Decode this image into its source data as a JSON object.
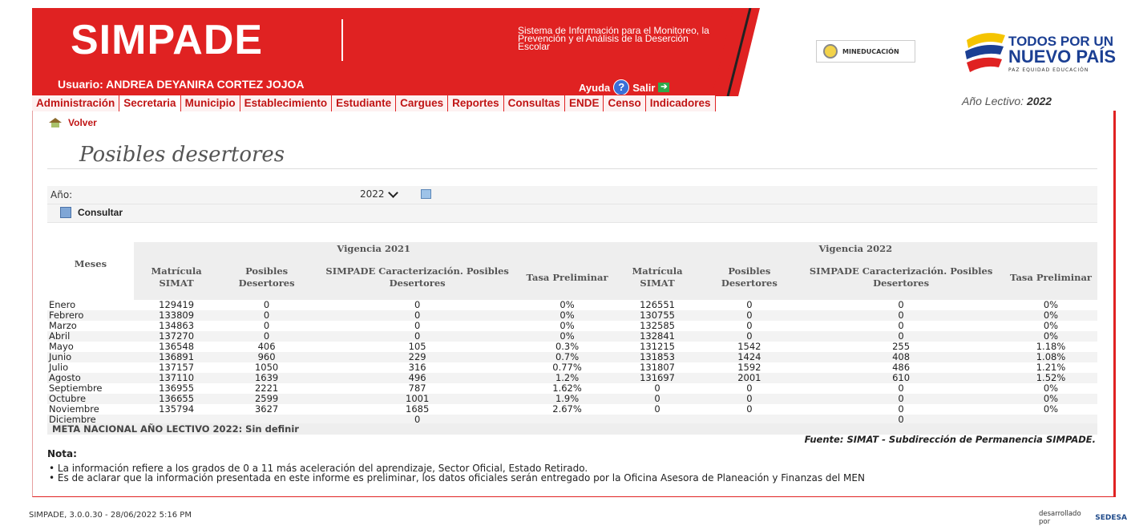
{
  "header": {
    "logo": "SIMPADE",
    "system_description": "Sistema de Información para el Monitoreo, la Prevención y el Análisis de la Deserción Escolar",
    "user": "Usuario: ANDREA DEYANIRA CORTEZ JOJOA",
    "help_label": "Ayuda",
    "exit_label": "Salir",
    "mineducacion": "MINEDUCACIÓN",
    "todos_line1": "TODOS POR UN",
    "todos_line2": "NUEVO PAÍS",
    "todos_tagline": "PAZ   EQUIDAD   EDUCACIÓN",
    "anio_lectivo_label": "Año Lectivo:",
    "anio_lectivo_value": "2022"
  },
  "nav": [
    "Administración",
    "Secretaria",
    "Municipio",
    "Establecimiento",
    "Estudiante",
    "Cargues",
    "Reportes",
    "Consultas",
    "ENDE",
    "Censo",
    "Indicadores"
  ],
  "volver_label": "Volver",
  "page_title": "Posibles desertores",
  "form": {
    "year_label": "Año:",
    "year_value": "2022",
    "consultar_label": "Consultar"
  },
  "table": {
    "meses_header": "Meses",
    "vigencia_2021": "Vigencia 2021",
    "vigencia_2022": "Vigencia 2022",
    "col_matricula": "Matrícula SIMAT",
    "col_posibles": "Posibles Desertores",
    "col_simpade": "SIMPADE Caracterización. Posibles Desertores",
    "col_tasa": "Tasa Preliminar",
    "rows": [
      [
        "Enero",
        "129419",
        "0",
        "0",
        "0%",
        "126551",
        "0",
        "0",
        "0%"
      ],
      [
        "Febrero",
        "133809",
        "0",
        "0",
        "0%",
        "130755",
        "0",
        "0",
        "0%"
      ],
      [
        "Marzo",
        "134863",
        "0",
        "0",
        "0%",
        "132585",
        "0",
        "0",
        "0%"
      ],
      [
        "Abril",
        "137270",
        "0",
        "0",
        "0%",
        "132841",
        "0",
        "0",
        "0%"
      ],
      [
        "Mayo",
        "136548",
        "406",
        "105",
        "0.3%",
        "131215",
        "1542",
        "255",
        "1.18%"
      ],
      [
        "Junio",
        "136891",
        "960",
        "229",
        "0.7%",
        "131853",
        "1424",
        "408",
        "1.08%"
      ],
      [
        "Julio",
        "137157",
        "1050",
        "316",
        "0.77%",
        "131807",
        "1592",
        "486",
        "1.21%"
      ],
      [
        "Agosto",
        "137110",
        "1639",
        "496",
        "1.2%",
        "131697",
        "2001",
        "610",
        "1.52%"
      ],
      [
        "Septiembre",
        "136955",
        "2221",
        "787",
        "1.62%",
        "0",
        "0",
        "0",
        "0%"
      ],
      [
        "Octubre",
        "136655",
        "2599",
        "1001",
        "1.9%",
        "0",
        "0",
        "0",
        "0%"
      ],
      [
        "Noviembre",
        "135794",
        "3627",
        "1685",
        "2.67%",
        "0",
        "0",
        "0",
        "0%"
      ],
      [
        "Diciembre",
        "",
        "",
        "0",
        "",
        "",
        "",
        "0",
        ""
      ]
    ]
  },
  "meta": "META NACIONAL AÑO LECTIVO 2022: Sin definir",
  "fuente": "Fuente: SIMAT - Subdirección de Permanencia SIMPADE.",
  "nota_title": "Nota:",
  "notas": [
    "La información refiere a los grados de 0 a 11 más aceleración del aprendizaje, Sector Oficial, Estado Retirado.",
    "Es de aclarar que la información presentada en este informe es preliminar, los datos oficiales serán entregado por la Oficina Asesora de Planeación y Finanzas del MEN"
  ],
  "footer": {
    "version": "SIMPADE, 3.0.0.30 - 28/06/2022 5:16 PM",
    "developed_by": "desarrollado por",
    "developer": "SEDESA"
  }
}
